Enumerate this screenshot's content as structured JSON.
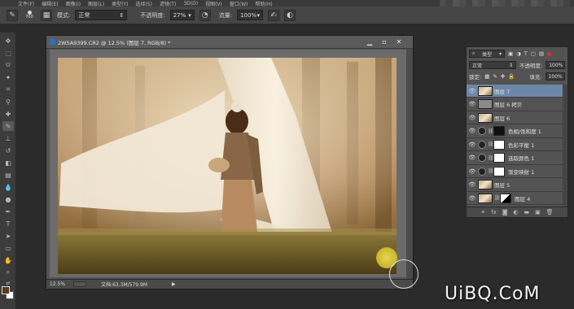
{
  "menubar": {
    "items": [
      "文件(F)",
      "编辑(E)",
      "图像(I)",
      "图层(L)",
      "类型(Y)",
      "选择(S)",
      "滤镜(T)",
      "3D(D)",
      "视图(V)",
      "窗口(W)",
      "帮助(H)"
    ]
  },
  "options_bar": {
    "brush_size": "700",
    "mode_label": "模式:",
    "mode_value": "正常",
    "opacity_label": "不透明度:",
    "opacity_value": "27%",
    "flow_label": "流量:",
    "flow_value": "100%"
  },
  "document": {
    "title": "2W5A9399.CR2 @ 12.5% (图层 7, RGB/8) *",
    "zoom": "12.5%",
    "doc_size": "文档:63.3M/579.9M"
  },
  "layers_panel": {
    "filter_label": "类型",
    "blend_mode": "正常",
    "opacity_label": "不透明度:",
    "opacity_value": "100%",
    "lock_label": "锁定:",
    "fill_label": "填充:",
    "fill_value": "100%",
    "layers": [
      {
        "name": "图层 7",
        "kind": "photo",
        "selected": true
      },
      {
        "name": "图层 6 拷贝",
        "kind": "gray",
        "selected": false
      },
      {
        "name": "图层 6",
        "kind": "photo",
        "selected": false
      },
      {
        "name": "色相/饱和度 1",
        "kind": "adj-black",
        "selected": false
      },
      {
        "name": "色彩平衡 1",
        "kind": "adj-white",
        "selected": false
      },
      {
        "name": "选取颜色 1",
        "kind": "adj-white",
        "selected": false
      },
      {
        "name": "渐变映射 1",
        "kind": "adj-white",
        "selected": false
      },
      {
        "name": "图层 5",
        "kind": "photo",
        "selected": false
      },
      {
        "name": "图层 4",
        "kind": "photo-mask",
        "selected": false
      }
    ],
    "footer_icons": [
      "link-icon",
      "fx-icon",
      "mask-icon",
      "adjustment-icon",
      "folder-icon",
      "new-layer-icon",
      "trash-icon"
    ]
  },
  "watermark": "UiBQ.CoM",
  "colors": {
    "ui_dark": "#2b2b2b",
    "panel": "#535353",
    "selected_layer": "#6e87a8",
    "foreground_swatch": "#5a3a22",
    "background_swatch": "#ffffff"
  }
}
